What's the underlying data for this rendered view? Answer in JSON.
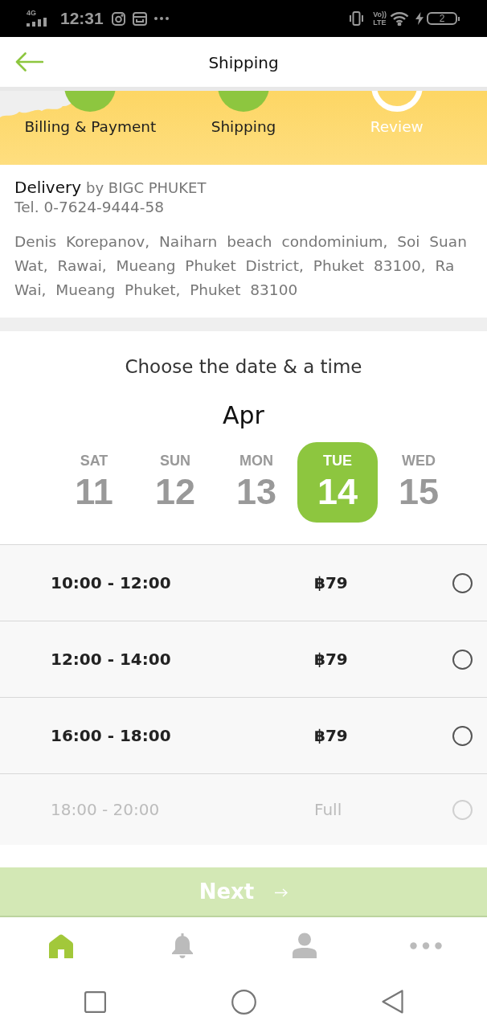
{
  "status_bar": {
    "network": "4G",
    "time": "12:31",
    "volte": [
      "Vo))",
      "LTE"
    ],
    "battery": "2"
  },
  "header": {
    "title": "Shipping"
  },
  "progress_steps": [
    {
      "label": "Billing & Payment",
      "done": true
    },
    {
      "label": "Shipping",
      "done": true
    },
    {
      "label": "Review",
      "done": false
    }
  ],
  "delivery": {
    "title": "Delivery",
    "store": "by BIGC PHUKET",
    "phone": "Tel. 0-7624-9444-58",
    "address": "Denis Korepanov, Naiharn beach condominium, Soi Suan Wat, Rawai, Mueang Phuket District, Phuket 83100, Ra Wai, Mueang Phuket, Phuket 83100"
  },
  "schedule": {
    "heading": "Choose the date & a time",
    "month": "Apr",
    "dates": [
      {
        "weekday": "SAT",
        "day": "11",
        "selected": false
      },
      {
        "weekday": "SUN",
        "day": "12",
        "selected": false
      },
      {
        "weekday": "MON",
        "day": "13",
        "selected": false
      },
      {
        "weekday": "TUE",
        "day": "14",
        "selected": true
      },
      {
        "weekday": "WED",
        "day": "15",
        "selected": false
      }
    ],
    "slots": [
      {
        "time": "10:00 - 12:00",
        "price": "฿79",
        "selected": false,
        "disabled": false
      },
      {
        "time": "12:00 - 14:00",
        "price": "฿79",
        "selected": false,
        "disabled": false
      },
      {
        "time": "16:00 - 18:00",
        "price": "฿79",
        "selected": false,
        "disabled": false
      },
      {
        "time": "18:00 - 20:00",
        "price": "Full",
        "selected": false,
        "disabled": true
      }
    ]
  },
  "next_button": {
    "label": "Next",
    "disabled": true
  },
  "bottom_nav": [
    {
      "kind": "home",
      "selected": true
    },
    {
      "kind": "bell",
      "selected": false
    },
    {
      "kind": "person",
      "selected": false
    },
    {
      "kind": "more",
      "selected": false
    }
  ]
}
